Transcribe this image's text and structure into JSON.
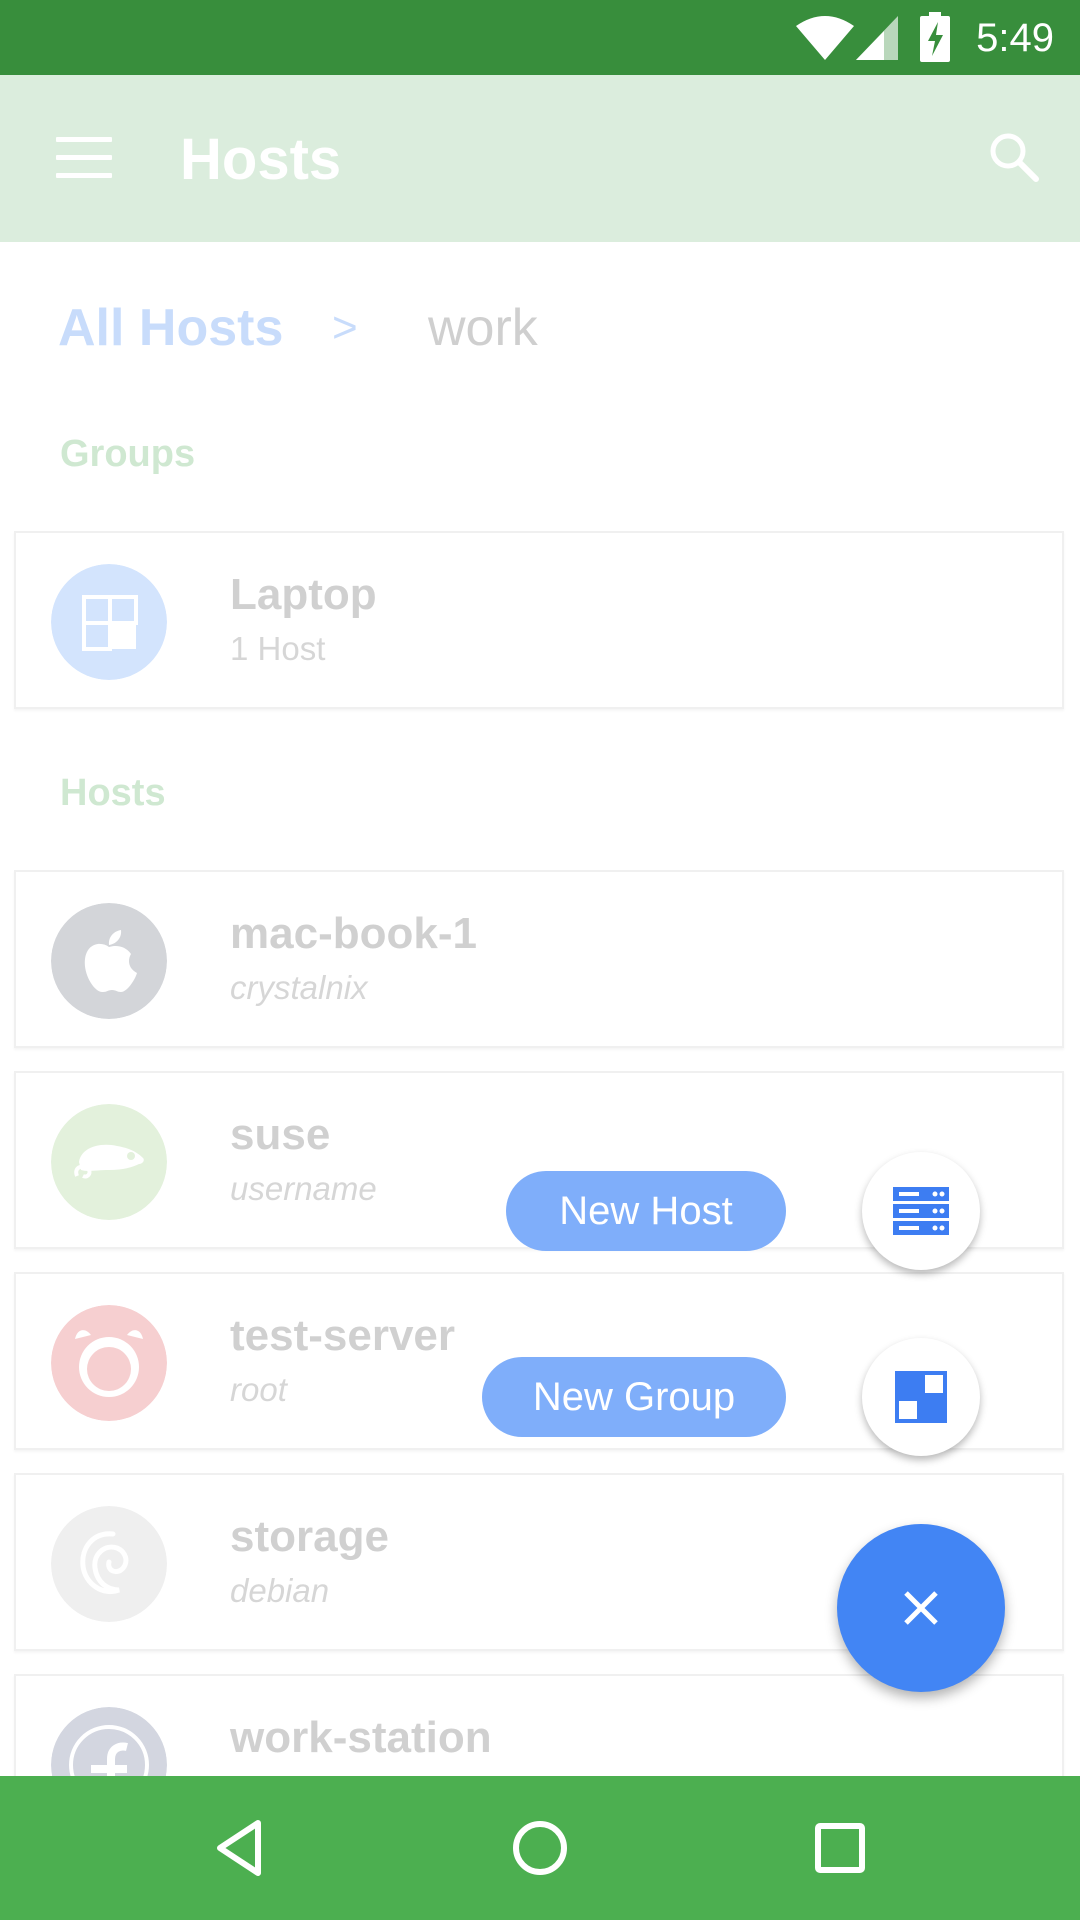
{
  "status_bar": {
    "time": "5:49"
  },
  "app_bar": {
    "title": "Hosts"
  },
  "breadcrumb": {
    "root": "All Hosts",
    "separator": ">",
    "current": "work"
  },
  "groups_section": {
    "label": "Groups",
    "items": [
      {
        "name": "Laptop",
        "count": "1 Host",
        "icon": "group-icon"
      }
    ]
  },
  "hosts_section": {
    "label": "Hosts",
    "items": [
      {
        "name": "mac-book-1",
        "user": "crystalnix",
        "icon": "apple-icon",
        "color": "#d3d5d9"
      },
      {
        "name": "suse",
        "user": "username",
        "icon": "suse-icon",
        "color": "#e3f1dc"
      },
      {
        "name": "test-server",
        "user": "root",
        "icon": "freebsd-icon",
        "color": "#f6cfd0"
      },
      {
        "name": "storage",
        "user": "debian",
        "icon": "debian-icon",
        "color": "#efefef"
      },
      {
        "name": "work-station",
        "user": "",
        "icon": "fedora-icon",
        "color": "#d3d6e0"
      }
    ]
  },
  "speed_dial": {
    "new_host_label": "New Host",
    "new_group_label": "New Group",
    "close_icon": "close-icon",
    "accent": "#4285f4"
  },
  "colors": {
    "status_bar": "#388e3c",
    "nav_bar": "#4caf50",
    "app_bar_dimmed": "#dbeddd"
  }
}
